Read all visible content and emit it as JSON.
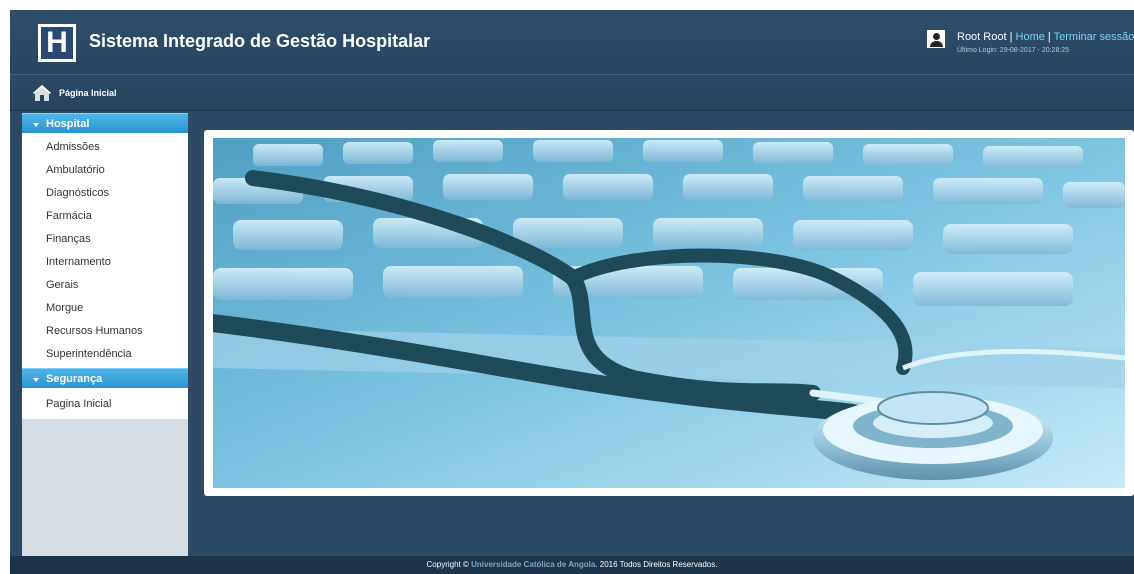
{
  "header": {
    "logo_letter": "H",
    "title": "Sistema Integrado de Gestão Hospitalar",
    "user_name": "Root Root",
    "separator": "|",
    "home_link": "Home",
    "logout_link": "Terminar sessão",
    "last_login": "Último Login: 29-08-2017 - 20:28:25"
  },
  "navbar": {
    "icon": "home-icon",
    "label": "Página Inicial"
  },
  "sidebar": {
    "sections": [
      {
        "title": "Hospital",
        "items": [
          "Admissões",
          "Ambulatório",
          "Diagnósticos",
          "Farmácia",
          "Finanças",
          "Internamento",
          "Gerais",
          "Morgue",
          "Recursos Humanos",
          "Superintendência"
        ]
      },
      {
        "title": "Segurança",
        "items": [
          "Pagina Inicial"
        ]
      }
    ]
  },
  "footer": {
    "prefix": "Copyright ©",
    "organization": "Universidade Católica de Angola.",
    "suffix": "2016 Todos Direitos Reservados."
  },
  "colors": {
    "header_bg": "#2f4e6b",
    "accent": "#2b93cf",
    "link": "#7fd3f5",
    "footer_bg": "#1d3347"
  }
}
